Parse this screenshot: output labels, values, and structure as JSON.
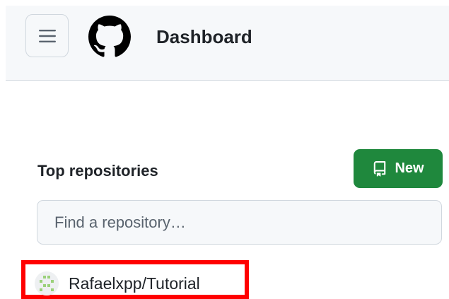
{
  "header": {
    "title": "Dashboard",
    "menu_icon": "hamburger-icon",
    "logo_icon": "github-logo-icon"
  },
  "top_repositories": {
    "title": "Top repositories",
    "new_button": {
      "label": "New",
      "icon": "repo-icon"
    },
    "search": {
      "placeholder": "Find a repository…",
      "value": ""
    },
    "repos": [
      {
        "name": "Rafaelxpp/Tutorial",
        "avatar_icon": "identicon-avatar",
        "highlighted": true
      }
    ]
  },
  "colors": {
    "accent_green": "#1f883d",
    "header_bg": "#f6f8fa",
    "highlight_red": "#ff0000",
    "text": "#1f2328"
  }
}
